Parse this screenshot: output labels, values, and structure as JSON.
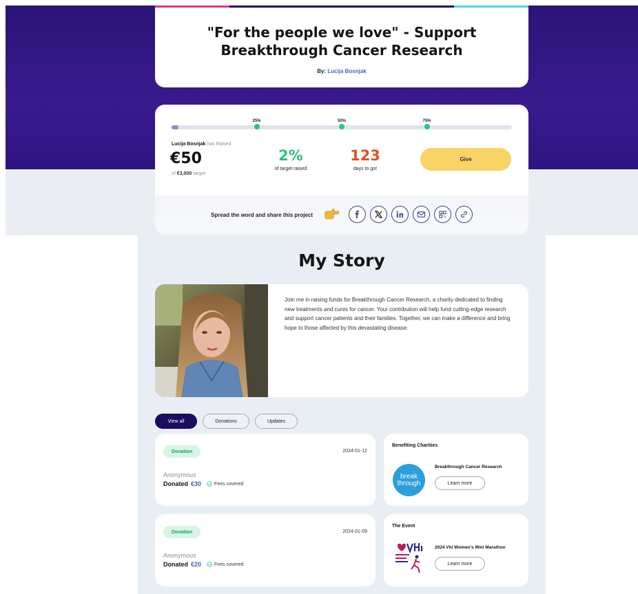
{
  "header": {
    "title_line1": "\"For the people we love\" - Support",
    "title_line2": "Breakthrough Cancer Research",
    "by_label": "By:",
    "author": "Lucija Bosnjak"
  },
  "progress": {
    "fraction_raised": 0.02,
    "milestones": [
      "25%",
      "50%",
      "75%"
    ]
  },
  "raised": {
    "name": "Lucija Bosnjak",
    "suffix": "has Raised",
    "amount": "€50",
    "target_prefix": "of",
    "target_amount": "€3,000",
    "target_suffix": "target"
  },
  "stats": {
    "percent": "2%",
    "percent_label": "of target raised",
    "days": "123",
    "days_label": "days to go!"
  },
  "give_label": "Give",
  "share": {
    "text": "Spread the word and share this project",
    "icons": [
      "facebook-icon",
      "x-icon",
      "linkedin-icon",
      "email-icon",
      "qr-code-icon",
      "link-icon"
    ]
  },
  "story": {
    "title": "My Story",
    "text": "Join me in raising funds for Breakthrough Cancer Research, a charity dedicated to finding new treatments and cures for cancer. Your contribution will help fund cutting-edge research and support cancer patients and their families. Together, we can make a difference and bring hope to those affected by this devastating disease."
  },
  "tabs": {
    "view_all": "View all",
    "donations": "Donations",
    "updates": "Updates"
  },
  "donations": [
    {
      "badge": "Donation",
      "date": "2024-01-12",
      "donor": "Anonymous",
      "donated_label": "Donated",
      "amount": "€30",
      "fees": "Fees covered"
    },
    {
      "badge": "Donation",
      "date": "2024-01-09",
      "donor": "Anonymous",
      "donated_label": "Donated",
      "amount": "€20",
      "fees": "Fees covered"
    }
  ],
  "charities": {
    "heading": "Benefiting Charities",
    "name": "Breakthrough Cancer Research",
    "logo_line1": "break",
    "logo_line2": "through",
    "button": "Learn more"
  },
  "event": {
    "heading": "The Event",
    "name": "2024 Vhi Women's Mini Marathon",
    "button": "Learn more"
  },
  "colors": {
    "hero": "#2a1478",
    "accent_blue": "#4063c9",
    "green": "#2ec27e",
    "orange": "#e2501f",
    "give_yellow": "#f7d465",
    "tab_active": "#1c0b63"
  }
}
